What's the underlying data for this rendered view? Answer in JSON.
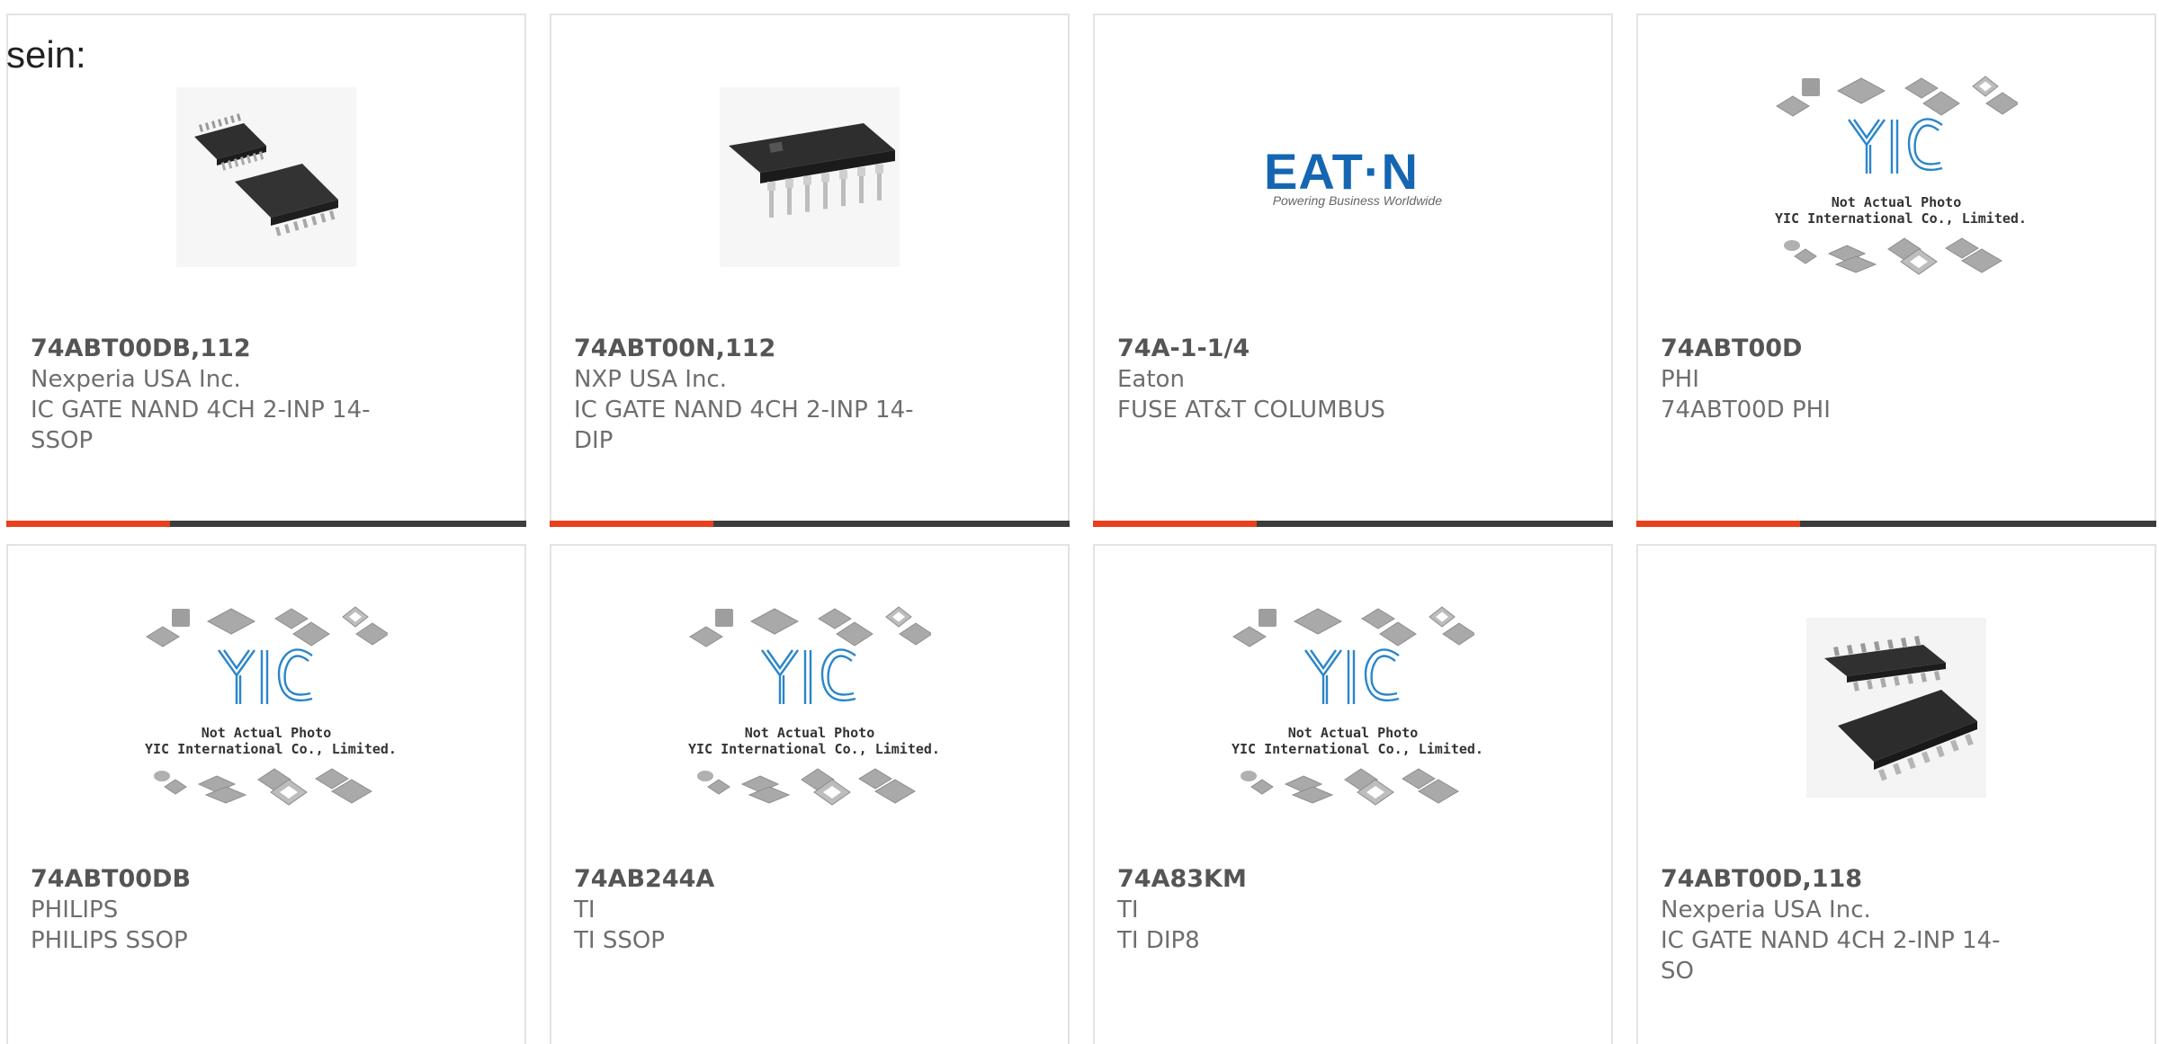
{
  "intro_text": "sein:",
  "colors": {
    "accent": "#e8401c",
    "bar": "#3d3d3d",
    "eaton_blue": "#1566b2",
    "yic_blue": "#2a86c9"
  },
  "products": [
    {
      "part": "74ABT00DB,112",
      "maker": "Nexperia USA Inc.",
      "desc": "IC GATE NAND 4CH 2-INP 14-SSOP",
      "image": "ssop-chip-photo"
    },
    {
      "part": "74ABT00N,112",
      "maker": "NXP USA Inc.",
      "desc": "IC GATE NAND 4CH 2-INP 14-DIP",
      "image": "dip-chip-photo"
    },
    {
      "part": "74A-1-1/4",
      "maker": "Eaton",
      "desc": "FUSE AT&T COLUMBUS",
      "image": "eaton-logo"
    },
    {
      "part": "74ABT00D",
      "maker": "PHI",
      "desc": "74ABT00D PHI",
      "image": "placeholder"
    },
    {
      "part": "74ABT00DB",
      "maker": "PHILIPS",
      "desc": "PHILIPS SSOP",
      "image": "placeholder"
    },
    {
      "part": "74AB244A",
      "maker": "TI",
      "desc": "TI SSOP",
      "image": "placeholder"
    },
    {
      "part": "74A83KM",
      "maker": "TI",
      "desc": "TI DIP8",
      "image": "placeholder"
    },
    {
      "part": "74ABT00D,118",
      "maker": "Nexperia USA Inc.",
      "desc": "IC GATE NAND 4CH 2-INP 14-SO",
      "image": "soic-chip-photo"
    }
  ],
  "eaton_logo": {
    "brand": "EAT·N",
    "tagline": "Powering Business Worldwide"
  },
  "placeholder": {
    "mark": "YIC",
    "line1": "Not Actual Photo",
    "line2": "YIC International Co., Limited."
  }
}
